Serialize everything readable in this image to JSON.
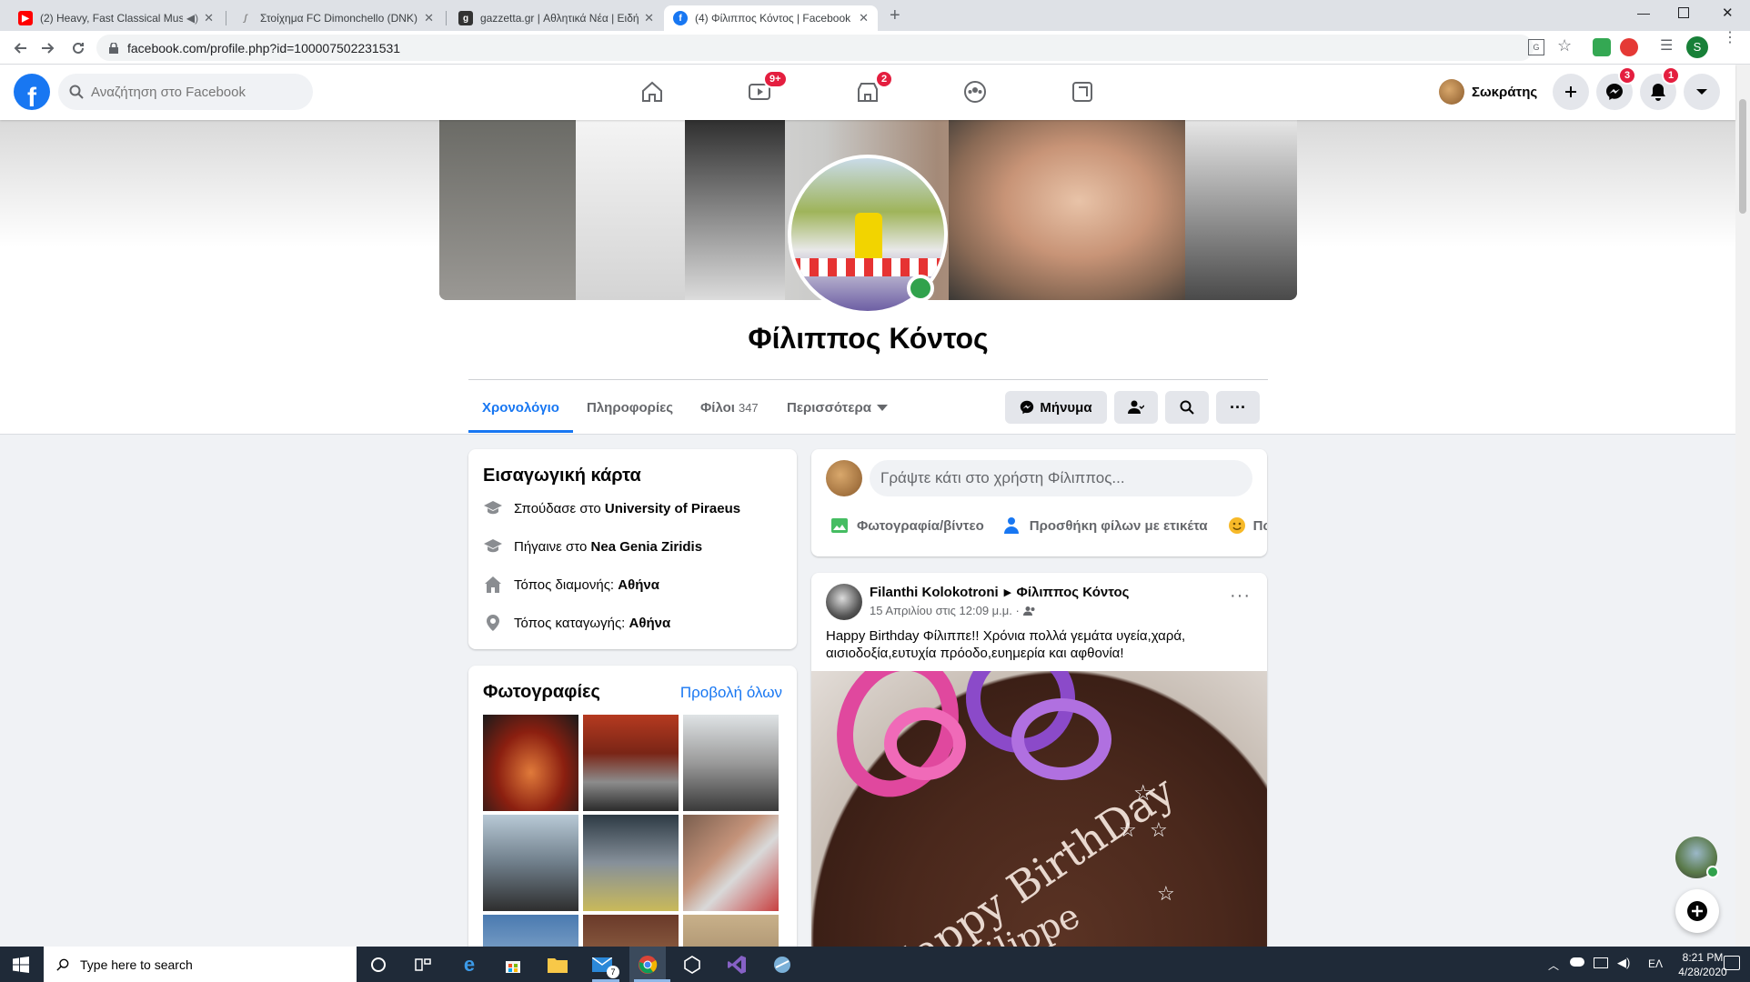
{
  "browser": {
    "tabs": [
      {
        "title": "(2) Heavy, Fast Classical Musi",
        "icon": "youtube-icon"
      },
      {
        "title": "Στοίχημα FC Dimonchello (DNK)",
        "icon": "betting-icon"
      },
      {
        "title": "gazzetta.gr | Αθλητικά Νέα | Ειδή",
        "icon": "gazzetta-icon"
      },
      {
        "title": "(4) Φίλιππος Κόντος | Facebook",
        "icon": "facebook-icon"
      }
    ],
    "url": "facebook.com/profile.php?id=100007502231531",
    "profile_initial": "S"
  },
  "fb": {
    "logo": "f",
    "search_placeholder": "Αναζήτηση στο Facebook",
    "watch_badge": "9+",
    "marketplace_badge": "2",
    "user_name": "Σωκράτης",
    "messenger_badge": "3",
    "notifications_badge": "1"
  },
  "profile": {
    "name": "Φίλιππος Κόντος",
    "tabs": {
      "timeline": "Χρονολόγιο",
      "about": "Πληροφορίες",
      "friends": "Φίλοι",
      "friends_count": "347",
      "more": "Περισσότερα"
    },
    "message_button": "Μήνυμα"
  },
  "intro": {
    "title": "Εισαγωγική κάρτα",
    "rows": [
      {
        "prefix": "Σπούδασε στο ",
        "value": "University of Piraeus"
      },
      {
        "prefix": "Πήγαινε στο ",
        "value": "Nea Genia Ziridis"
      },
      {
        "prefix": "Τόπος διαμονής: ",
        "value": "Αθήνα"
      },
      {
        "prefix": "Τόπος καταγωγής: ",
        "value": "Αθήνα"
      }
    ]
  },
  "photos": {
    "title": "Φωτογραφίες",
    "see_all": "Προβολή όλων"
  },
  "composer": {
    "placeholder": "Γράψτε κάτι στο χρήστη Φίλιππος...",
    "photo_video": "Φωτογραφία/βίντεο",
    "tag_friends": "Προσθήκη φίλων με ετικέτα",
    "feeling": "Πώ"
  },
  "post": {
    "author": "Filanthi Kolokotroni",
    "arrow": "▸",
    "target": "Φίλιππος Κόντος",
    "time": "15 Απριλίου στις 12:09 μ.μ. ·",
    "text": "Happy Birthday Φίλιππε!! Χρόνια πολλά γεμάτα υγεία,χαρά, αισιοδοξία,ευτυχία πρόοδο,ευημερία και αφθονία!",
    "image_text": "Happy BirthDay",
    "image_text2": "ilippe"
  },
  "taskbar": {
    "search_placeholder": "Type here to search",
    "time": "8:21 PM",
    "date": "4/28/2020",
    "lang": "ΕΛ",
    "mail_badge": "7"
  }
}
